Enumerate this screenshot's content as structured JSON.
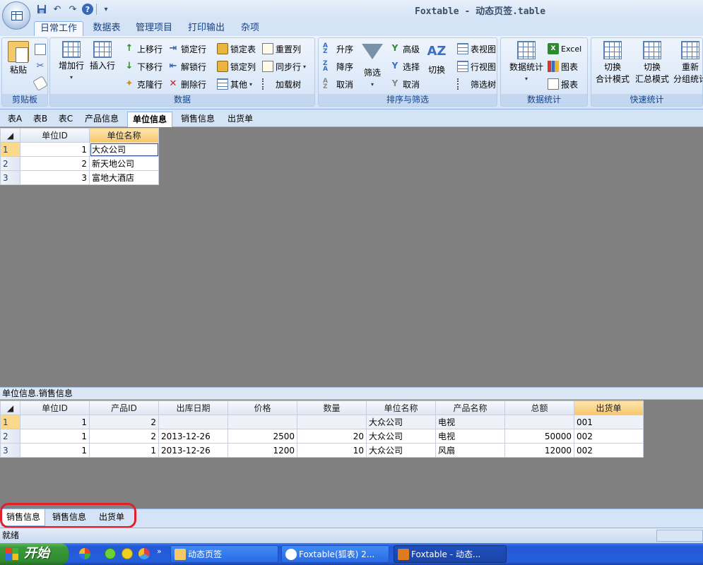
{
  "window": {
    "title": "Foxtable - 动态页签.table"
  },
  "qat": {
    "help_icon": "help-icon",
    "menu_glyph": "▾"
  },
  "ribbon_tabs": [
    "日常工作",
    "数据表",
    "管理项目",
    "打印输出",
    "杂项"
  ],
  "groups": {
    "clipboard": {
      "label": "剪贴板",
      "paste": "粘贴"
    },
    "data": {
      "label": "数据",
      "add_row": "增加行",
      "insert_row": "插入行",
      "move_up": "上移行",
      "move_down": "下移行",
      "clone_row": "克隆行",
      "lock_row": "锁定行",
      "unlock_row": "解锁行",
      "delete_row": "删除行",
      "lock_table": "锁定表",
      "lock_col": "锁定列",
      "other": "其他",
      "reset_col": "重置列",
      "sync_row": "同步行",
      "load_tree": "加载树"
    },
    "sort_filter": {
      "label": "排序与筛选",
      "asc": "升序",
      "desc": "降序",
      "cancel": "取消",
      "filter": "筛选",
      "advanced": "高级",
      "select": "选择",
      "cancel2": "取消",
      "toggle": "切换",
      "table_view": "表视图",
      "row_view": "行视图",
      "filter_tree": "筛选树"
    },
    "stats": {
      "label": "数据统计",
      "stats_btn": "数据统计",
      "excel": "Excel",
      "chart": "图表",
      "report": "报表"
    },
    "quick_stats": {
      "label": "快速统计",
      "btn1_l1": "切换",
      "btn1_l2": "合计模式",
      "btn2_l1": "切换",
      "btn2_l2": "汇总模式",
      "btn3_l1": "重新",
      "btn3_l2": "分组统计"
    }
  },
  "sheet_tabs": [
    "表A",
    "表B",
    "表C",
    "产品信息",
    "单位信息",
    "销售信息",
    "出货单"
  ],
  "main_table": {
    "headers": [
      "单位ID",
      "单位名称"
    ],
    "rows": [
      {
        "rn": "1",
        "id": "1",
        "name": "大众公司"
      },
      {
        "rn": "2",
        "id": "2",
        "name": "新天地公司"
      },
      {
        "rn": "3",
        "id": "3",
        "name": "富地大酒店"
      }
    ]
  },
  "sub_caption": "单位信息.销售信息",
  "sub_table": {
    "headers": [
      "单位ID",
      "产品ID",
      "出库日期",
      "价格",
      "数量",
      "单位名称",
      "产品名称",
      "总额",
      "出货单"
    ],
    "rows": [
      {
        "rn": "1",
        "c": [
          "1",
          "2",
          "",
          "",
          "",
          "大众公司",
          "电视",
          "",
          "001"
        ]
      },
      {
        "rn": "2",
        "c": [
          "1",
          "2",
          "2013-12-26",
          "2500",
          "20",
          "大众公司",
          "电视",
          "50000",
          "002"
        ]
      },
      {
        "rn": "3",
        "c": [
          "1",
          "1",
          "2013-12-26",
          "1200",
          "10",
          "大众公司",
          "风扇",
          "12000",
          "002"
        ]
      }
    ]
  },
  "bottom_tabs": [
    "销售信息",
    "销售信息",
    "出货单"
  ],
  "status": "就绪",
  "taskbar": {
    "start": "开始",
    "chevron": "»",
    "tasks": [
      "动态页签",
      "Foxtable(狐表) 2...",
      "Foxtable - 动态..."
    ]
  },
  "colors": {
    "accent": "#15428b",
    "highlight_ring": "#e0202a",
    "selected_header": "#f8c56a"
  }
}
